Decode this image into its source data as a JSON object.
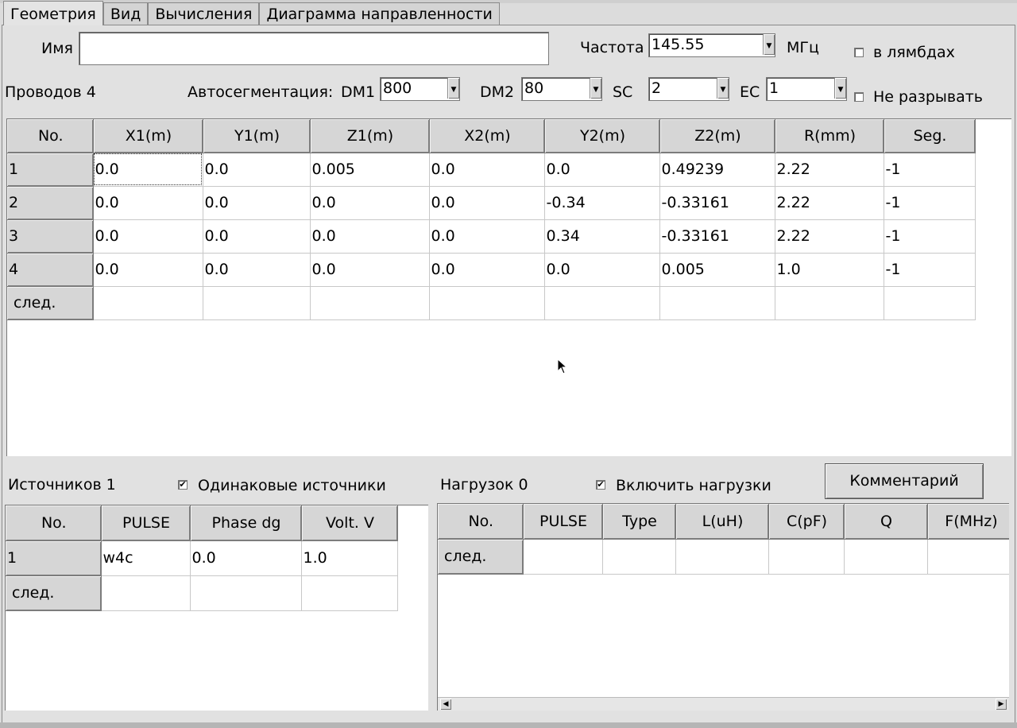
{
  "tabs": [
    "Геометрия",
    "Вид",
    "Вычисления",
    "Диаграмма направленности"
  ],
  "header": {
    "name_label": "Имя",
    "name_value": "",
    "freq_label": "Частота",
    "freq_value": "145.55",
    "freq_unit": "МГц",
    "lambda_label": "в лямбдах",
    "wires_label": "Проводов 4",
    "autoseg_label": "Автосегментация:",
    "dm1_label": "DM1",
    "dm1_value": "800",
    "dm2_label": "DM2",
    "dm2_value": "80",
    "sc_label": "SC",
    "sc_value": "2",
    "ec_label": "EC",
    "ec_value": "1",
    "nobreak_label": "Не разрывать"
  },
  "wires": {
    "columns": [
      "No.",
      "X1(m)",
      "Y1(m)",
      "Z1(m)",
      "X2(m)",
      "Y2(m)",
      "Z2(m)",
      "R(mm)",
      "Seg."
    ],
    "rows": [
      [
        "1",
        "0.0",
        "0.0",
        "0.005",
        "0.0",
        "0.0",
        "0.49239",
        "2.22",
        "-1"
      ],
      [
        "2",
        "0.0",
        "0.0",
        "0.0",
        "0.0",
        "-0.34",
        "-0.33161",
        "2.22",
        "-1"
      ],
      [
        "3",
        "0.0",
        "0.0",
        "0.0",
        "0.0",
        "0.34",
        "-0.33161",
        "2.22",
        "-1"
      ],
      [
        "4",
        "0.0",
        "0.0",
        "0.0",
        "0.0",
        "0.0",
        "0.005",
        "1.0",
        "-1"
      ]
    ],
    "next_label": "след."
  },
  "sources": {
    "count_label": "Источников 1",
    "same_label": "Одинаковые источники",
    "same_checked": "✔",
    "columns": [
      "No.",
      "PULSE",
      "Phase dg",
      "Volt. V"
    ],
    "rows": [
      [
        "1",
        "w4c",
        "0.0",
        "1.0"
      ]
    ],
    "next_label": "след."
  },
  "loads": {
    "count_label": "Нагрузок 0",
    "enable_label": "Включить нагрузки",
    "enable_checked": "✔",
    "comment_button": "Комментарий",
    "columns": [
      "No.",
      "PULSE",
      "Type",
      "L(uH)",
      "C(pF)",
      "Q",
      "F(MHz)"
    ],
    "next_label": "след."
  }
}
